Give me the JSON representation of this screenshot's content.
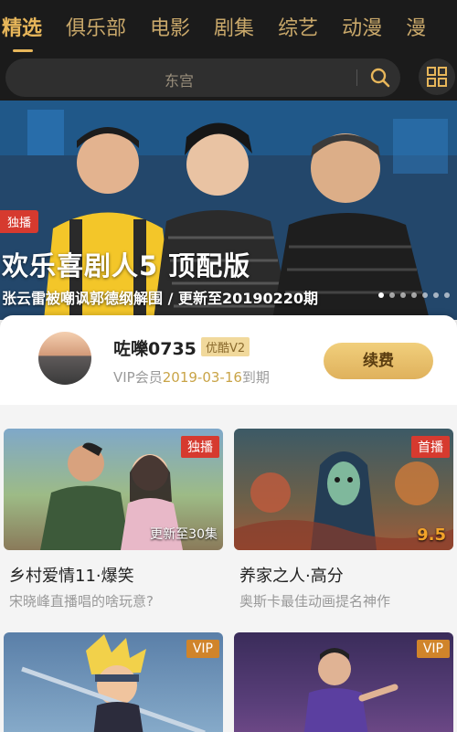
{
  "nav": {
    "tabs": [
      {
        "label": "精选"
      },
      {
        "label": "俱乐部"
      },
      {
        "label": "电影"
      },
      {
        "label": "剧集"
      },
      {
        "label": "综艺"
      },
      {
        "label": "动漫"
      },
      {
        "label": "漫"
      }
    ],
    "active_index": 0
  },
  "search": {
    "placeholder": "东宫",
    "icon": "search-icon",
    "menu_icon": "grid-icon"
  },
  "hero": {
    "badge": "独播",
    "title": "欢乐喜剧人5 顶配版",
    "subtitle": "张云雷被嘲讽郭德纲解围 / 更新至20190220期",
    "dots": 7,
    "active_dot": 0
  },
  "vip": {
    "username": "咗嚛0735",
    "level": "优酷V2",
    "expiry_prefix": "VIP会员",
    "expiry_date": "2019-03-16",
    "expiry_suffix": "到期",
    "renew_label": "续费"
  },
  "cards": [
    {
      "tag": "独播",
      "overlay": "更新至30集",
      "title": "乡村爱情11·爆笑",
      "desc": "宋晓峰直播唱的啥玩意?"
    },
    {
      "tag": "首播",
      "score": "9.5",
      "title": "养家之人·高分",
      "desc": "奥斯卡最佳动画提名神作"
    },
    {
      "tag": "VIP"
    },
    {
      "tag": "VIP"
    }
  ],
  "colors": {
    "nav_bg": "#1b1b1b",
    "accent_gold": "#e7b65a",
    "tag_red": "#d63a2f",
    "tag_vip": "#d0842a"
  }
}
